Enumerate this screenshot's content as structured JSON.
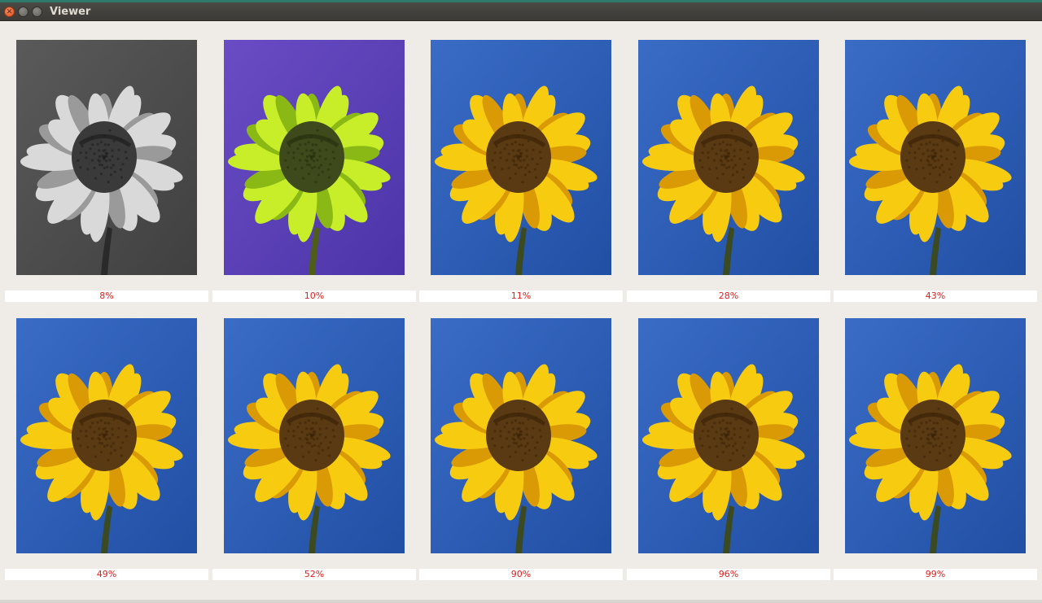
{
  "window": {
    "title": "Viewer"
  },
  "results": [
    {
      "label": "8%",
      "style": "gray"
    },
    {
      "label": "10%",
      "style": "lime-purple"
    },
    {
      "label": "11%",
      "style": "normal"
    },
    {
      "label": "28%",
      "style": "normal"
    },
    {
      "label": "43%",
      "style": "normal"
    },
    {
      "label": "49%",
      "style": "normal"
    },
    {
      "label": "52%",
      "style": "normal"
    },
    {
      "label": "90%",
      "style": "normal"
    },
    {
      "label": "96%",
      "style": "normal"
    },
    {
      "label": "99%",
      "style": "normal"
    }
  ],
  "palettes": {
    "normal": {
      "bg1": "#3a6cc6",
      "bg2": "#214fa4",
      "petal": "#f7cc10",
      "petalDark": "#d99a06",
      "center": "#5a3a12",
      "centerRim": "#3a2408",
      "stem": "#3c4a22"
    },
    "gray": {
      "bg1": "#5a5a5a",
      "bg2": "#404040",
      "petal": "#d9d9d9",
      "petalDark": "#9a9a9a",
      "center": "#3a3a3a",
      "centerRim": "#1e1e1e",
      "stem": "#2a2a2a"
    },
    "lime-purple": {
      "bg1": "#6a4cc4",
      "bg2": "#4c34a8",
      "petal": "#c8ee2a",
      "petalDark": "#8ab814",
      "center": "#3e4a1c",
      "centerRim": "#27300e",
      "stem": "#4e5e18"
    }
  },
  "colors": {
    "label_text": "#e0201c",
    "window_bg": "#efebe7"
  }
}
